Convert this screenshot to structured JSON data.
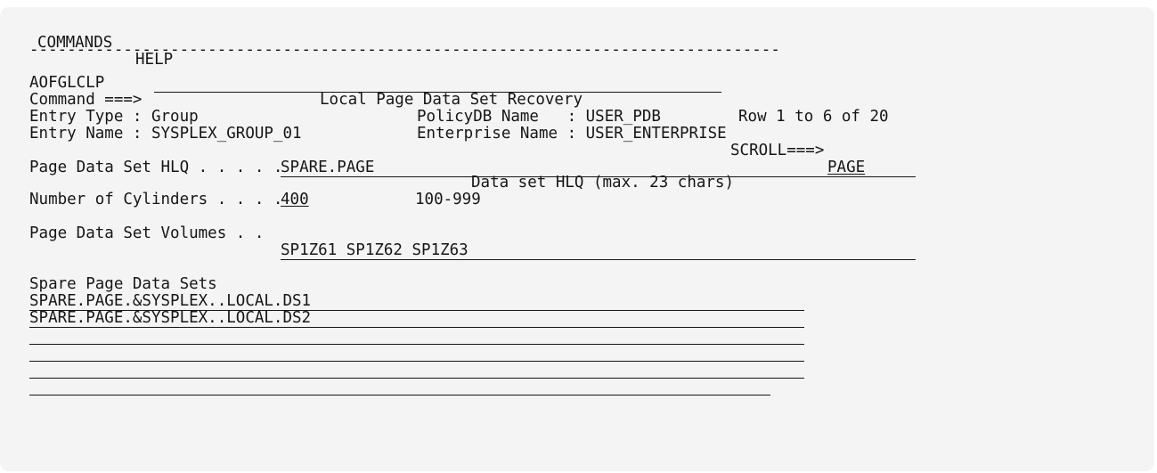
{
  "menu": {
    "commands_label": "COMMANDS",
    "help_label": "HELP"
  },
  "separator": "--------------------------------------------------------------------------------",
  "header": {
    "panel_id": "AOFGLCLP",
    "title": "Local Page Data Set Recovery",
    "row_info": "Row 1 to 6 of 20",
    "command_label": "Command ===>",
    "command_value": "",
    "scroll_label": "SCROLL===>",
    "scroll_value": "PAGE"
  },
  "entry": {
    "type_label": "Entry Type : Group",
    "name_label": "Entry Name : SYSPLEX_GROUP_01",
    "policydb_label": "PolicyDB Name   : USER_PDB",
    "enterprise_label": "Enterprise Name : USER_ENTERPRISE"
  },
  "fields": {
    "hlq_label": "Page Data Set HLQ . . . . .",
    "hlq_value": "SPARE.PAGE",
    "hlq_hint": "Data set HLQ (max. 23 chars)",
    "cyl_label": "Number of Cylinders . . . .",
    "cyl_value": "400",
    "cyl_range": "100-999",
    "volumes_label": "Page Data Set Volumes . .",
    "volumes_value": "SP1Z61 SP1Z62 SP1Z63"
  },
  "spare": {
    "heading": "Spare Page Data Sets",
    "rows": [
      "SPARE.PAGE.&SYSPLEX..LOCAL.DS1",
      "SPARE.PAGE.&SYSPLEX..LOCAL.DS2",
      "",
      "",
      "",
      ""
    ]
  }
}
